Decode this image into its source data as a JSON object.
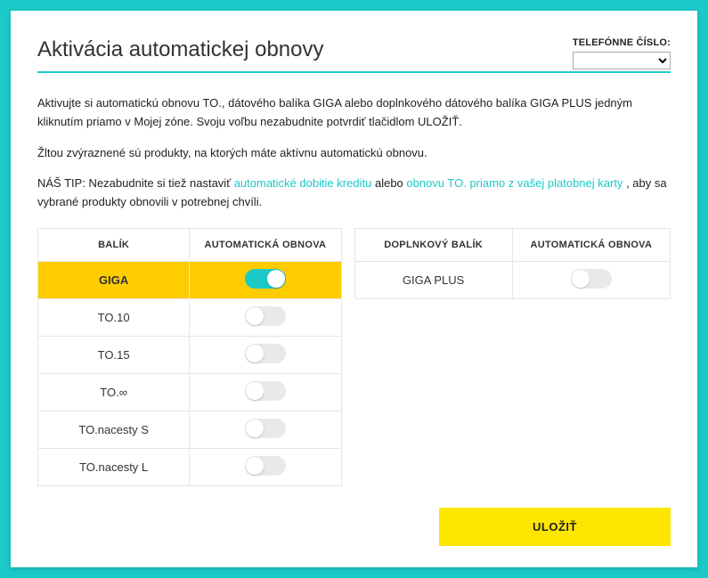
{
  "header": {
    "title": "Aktivácia automatickej obnovy",
    "phone_label": "TELEFÓNNE ČÍSLO:"
  },
  "intro": {
    "p1": "Aktivujte si automatickú obnovu TO., dátového balíka GIGA alebo doplnkového dátového balíka GIGA PLUS jedným kliknutím priamo v Mojej zóne. Svoju voľbu nezabudnite potvrdiť tlačidlom ULOŽIŤ.",
    "p2": "Žltou zvýraznené sú produkty, na ktorých máte aktívnu automatickú obnovu.",
    "tip_prefix": "NÁŠ TIP: Nezabudnite si tiež nastaviť ",
    "tip_link1": "automatické dobitie kreditu",
    "tip_mid": " alebo ",
    "tip_link2": "obnovu TO. priamo z vašej platobnej karty",
    "tip_suffix": ", aby sa vybrané produkty obnovili v potrebnej chvíli."
  },
  "table_left": {
    "col1": "BALÍK",
    "col2": "AUTOMATICKÁ OBNOVA",
    "rows": [
      {
        "name": "GIGA",
        "on": true
      },
      {
        "name": "TO.10",
        "on": false
      },
      {
        "name": "TO.15",
        "on": false
      },
      {
        "name": "TO.∞",
        "on": false
      },
      {
        "name": "TO.nacesty S",
        "on": false
      },
      {
        "name": "TO.nacesty L",
        "on": false
      }
    ]
  },
  "table_right": {
    "col1": "DOPLNKOVÝ BALÍK",
    "col2": "AUTOMATICKÁ OBNOVA",
    "rows": [
      {
        "name": "GIGA PLUS",
        "on": false
      }
    ]
  },
  "footer": {
    "save": "ULOŽIŤ"
  }
}
